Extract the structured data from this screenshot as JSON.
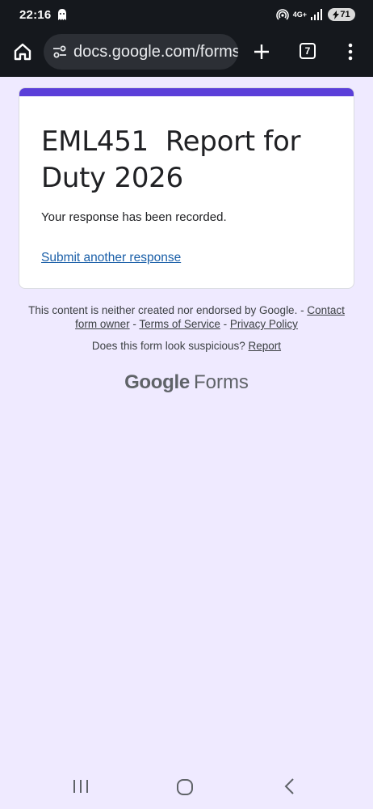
{
  "status_bar": {
    "time": "22:16",
    "network": "4G+",
    "battery": "71",
    "icons": [
      "ghost-icon",
      "hotspot-icon",
      "signal-icon",
      "battery-icon"
    ]
  },
  "browser": {
    "url": "docs.google.com/forms",
    "tab_count": "7",
    "icons": [
      "home-icon",
      "tune-icon",
      "plus-icon",
      "more-vert-icon"
    ]
  },
  "form": {
    "title": "EML451  Report for Duty 2026",
    "confirmation": "Your response has been recorded.",
    "submit_another": "Submit another response",
    "accent_color": "#5b3fd9"
  },
  "footer": {
    "disclaimer": "This content is neither created nor endorsed by Google.",
    "separator": " - ",
    "contact_owner": "Contact form owner",
    "terms": "Terms of Service",
    "privacy": "Privacy Policy",
    "suspicious_question": "Does this form look suspicious?",
    "report": "Report",
    "brand_google": "Google",
    "brand_forms": "Forms"
  },
  "nav": {
    "icons": [
      "recents-icon",
      "home-circle-icon",
      "back-icon"
    ]
  },
  "colors": {
    "page_background": "#efeaff",
    "link": "#1a5fa8"
  }
}
